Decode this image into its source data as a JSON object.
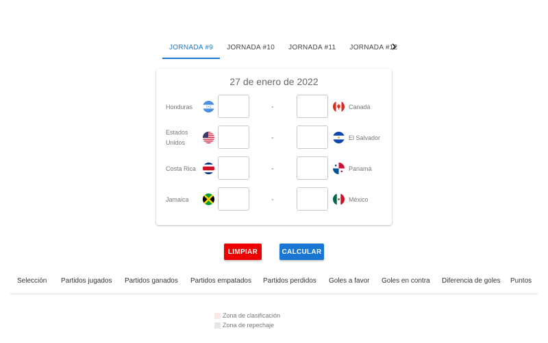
{
  "tabs": {
    "items": [
      {
        "label": "JORNADA #9",
        "active": true
      },
      {
        "label": "JORNADA #10",
        "active": false
      },
      {
        "label": "JORNADA #11",
        "active": false
      },
      {
        "label": "JORNADA #12",
        "active": false
      }
    ],
    "next_icon": "chevron-right-icon"
  },
  "card": {
    "date": "27 de enero de 2022",
    "separator": "-",
    "matches": [
      {
        "home": "Honduras",
        "home_flag": "honduras-flag-icon",
        "away": "Canadá",
        "away_flag": "canada-flag-icon",
        "home_score": "",
        "away_score": ""
      },
      {
        "home": "Estados Unidos",
        "home_flag": "usa-flag-icon",
        "away": "El Salvador",
        "away_flag": "el-salvador-flag-icon",
        "home_score": "",
        "away_score": ""
      },
      {
        "home": "Costa Rica",
        "home_flag": "costa-rica-flag-icon",
        "away": "Panamá",
        "away_flag": "panama-flag-icon",
        "home_score": "",
        "away_score": ""
      },
      {
        "home": "Jamaica",
        "home_flag": "jamaica-flag-icon",
        "away": "México",
        "away_flag": "mexico-flag-icon",
        "home_score": "",
        "away_score": ""
      }
    ]
  },
  "buttons": {
    "clear_label": "LIMPIAR",
    "calc_label": "CALCULAR",
    "clear_color": "#ee0000",
    "calc_color": "#1976d2"
  },
  "table": {
    "headers": [
      "Selección",
      "Partidos jugados",
      "Partidos ganados",
      "Partidos empatados",
      "Partidos perdidos",
      "Goles a favor",
      "Goles en contra",
      "Diferencia de goles",
      "Puntos"
    ]
  },
  "legend": {
    "items": [
      {
        "label": "Zona de clasificación",
        "color": "#fde8e6"
      },
      {
        "label": "Zona de repechaje",
        "color": "#e6e6e6"
      }
    ]
  }
}
